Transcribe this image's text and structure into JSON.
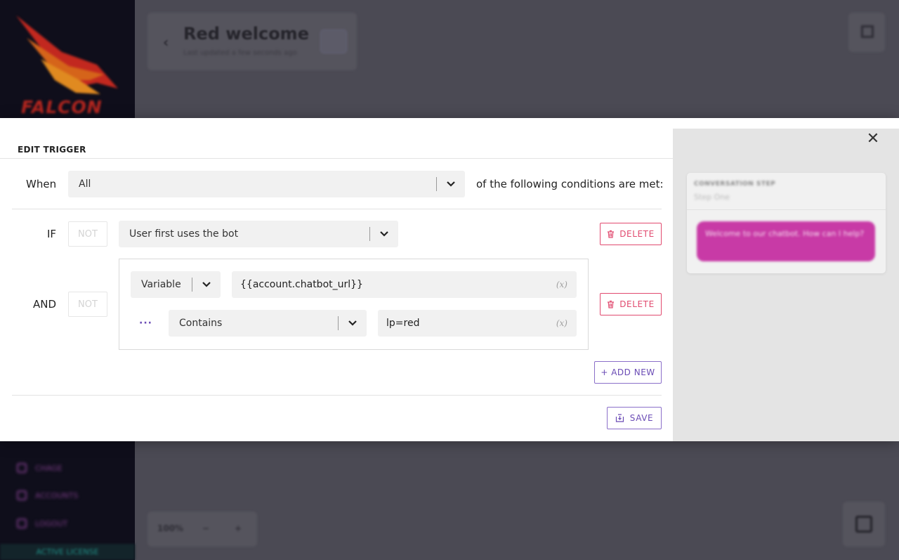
{
  "background": {
    "brand": "FALCON",
    "page_title": "Red welcome",
    "page_subtitle": "Last updated a few seconds ago",
    "nav": [
      {
        "label": "CHAGE"
      },
      {
        "label": "ACCOUNTS"
      },
      {
        "label": "LOGOUT"
      }
    ],
    "license": "ACTIVE LICENSE",
    "zoom": {
      "value": "100%",
      "minus": "−",
      "plus": "+"
    }
  },
  "modal": {
    "title": "EDIT TRIGGER",
    "close_icon": "close-icon"
  },
  "trigger": {
    "when_label": "When",
    "match_mode": "All",
    "suffix": "of the following conditions are met:",
    "if_label": "IF",
    "not_label": "NOT",
    "if_condition": "User first uses the bot",
    "and_label": "AND",
    "and_not_label": "NOT",
    "source_type": "Variable",
    "variable": "{{account.chatbot_url}}",
    "variable_hint": "(x)",
    "more_label": "···",
    "operator": "Contains",
    "value": "lp=red",
    "value_hint": "(x)",
    "delete_label": "DELETE",
    "delete_label_2": "DELETE",
    "add_new_label": "+ ADD NEW",
    "save_label": "SAVE"
  },
  "preview": {
    "section_label": "CONVERSATION STEP",
    "step_name": "Step One",
    "message": "Welcome to our chatbot. How can I help?"
  },
  "colors": {
    "accent_purple": "#6a4bb5",
    "delete_red": "#e14a6f",
    "bubble_pink": "#c83aa6"
  }
}
